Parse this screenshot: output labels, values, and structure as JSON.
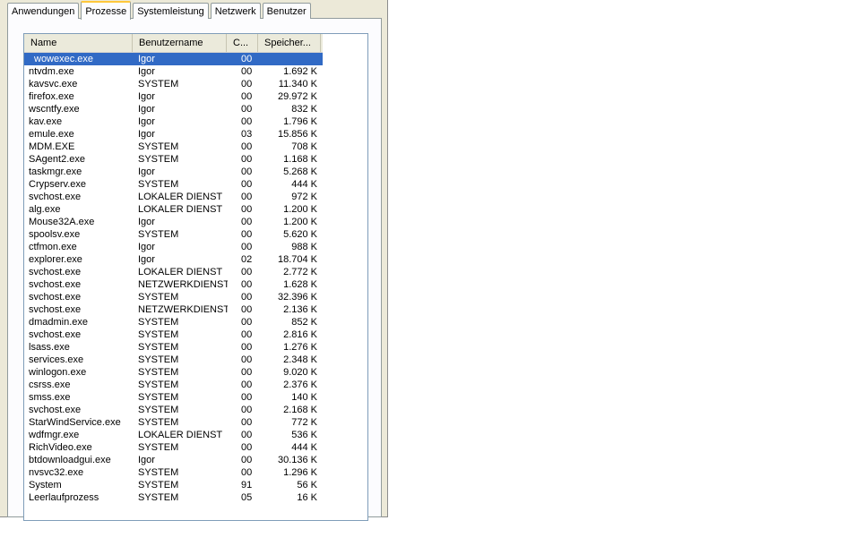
{
  "tabs": [
    {
      "label": "Anwendungen",
      "active": false
    },
    {
      "label": "Prozesse",
      "active": true
    },
    {
      "label": "Systemleistung",
      "active": false
    },
    {
      "label": "Netzwerk",
      "active": false
    },
    {
      "label": "Benutzer",
      "active": false
    }
  ],
  "columns": {
    "name": "Name",
    "user": "Benutzername",
    "cpu": "C...",
    "mem": "Speicher..."
  },
  "selected_index": 0,
  "colors": {
    "selection": "#316ac5",
    "window_bg": "#ece9d8"
  },
  "rows": [
    {
      "name": "wowexec.exe",
      "user": "Igor",
      "cpu": "00",
      "mem": ""
    },
    {
      "name": "ntvdm.exe",
      "user": "Igor",
      "cpu": "00",
      "mem": "1.692 K"
    },
    {
      "name": "kavsvc.exe",
      "user": "SYSTEM",
      "cpu": "00",
      "mem": "11.340 K"
    },
    {
      "name": "firefox.exe",
      "user": "Igor",
      "cpu": "00",
      "mem": "29.972 K"
    },
    {
      "name": "wscntfy.exe",
      "user": "Igor",
      "cpu": "00",
      "mem": "832 K"
    },
    {
      "name": "kav.exe",
      "user": "Igor",
      "cpu": "00",
      "mem": "1.796 K"
    },
    {
      "name": "emule.exe",
      "user": "Igor",
      "cpu": "03",
      "mem": "15.856 K"
    },
    {
      "name": "MDM.EXE",
      "user": "SYSTEM",
      "cpu": "00",
      "mem": "708 K"
    },
    {
      "name": "SAgent2.exe",
      "user": "SYSTEM",
      "cpu": "00",
      "mem": "1.168 K"
    },
    {
      "name": "taskmgr.exe",
      "user": "Igor",
      "cpu": "00",
      "mem": "5.268 K"
    },
    {
      "name": "Crypserv.exe",
      "user": "SYSTEM",
      "cpu": "00",
      "mem": "444 K"
    },
    {
      "name": "svchost.exe",
      "user": "LOKALER DIENST",
      "cpu": "00",
      "mem": "972 K"
    },
    {
      "name": "alg.exe",
      "user": "LOKALER DIENST",
      "cpu": "00",
      "mem": "1.200 K"
    },
    {
      "name": "Mouse32A.exe",
      "user": "Igor",
      "cpu": "00",
      "mem": "1.200 K"
    },
    {
      "name": "spoolsv.exe",
      "user": "SYSTEM",
      "cpu": "00",
      "mem": "5.620 K"
    },
    {
      "name": "ctfmon.exe",
      "user": "Igor",
      "cpu": "00",
      "mem": "988 K"
    },
    {
      "name": "explorer.exe",
      "user": "Igor",
      "cpu": "02",
      "mem": "18.704 K"
    },
    {
      "name": "svchost.exe",
      "user": "LOKALER DIENST",
      "cpu": "00",
      "mem": "2.772 K"
    },
    {
      "name": "svchost.exe",
      "user": "NETZWERKDIENST",
      "cpu": "00",
      "mem": "1.628 K"
    },
    {
      "name": "svchost.exe",
      "user": "SYSTEM",
      "cpu": "00",
      "mem": "32.396 K"
    },
    {
      "name": "svchost.exe",
      "user": "NETZWERKDIENST",
      "cpu": "00",
      "mem": "2.136 K"
    },
    {
      "name": "dmadmin.exe",
      "user": "SYSTEM",
      "cpu": "00",
      "mem": "852 K"
    },
    {
      "name": "svchost.exe",
      "user": "SYSTEM",
      "cpu": "00",
      "mem": "2.816 K"
    },
    {
      "name": "lsass.exe",
      "user": "SYSTEM",
      "cpu": "00",
      "mem": "1.276 K"
    },
    {
      "name": "services.exe",
      "user": "SYSTEM",
      "cpu": "00",
      "mem": "2.348 K"
    },
    {
      "name": "winlogon.exe",
      "user": "SYSTEM",
      "cpu": "00",
      "mem": "9.020 K"
    },
    {
      "name": "csrss.exe",
      "user": "SYSTEM",
      "cpu": "00",
      "mem": "2.376 K"
    },
    {
      "name": "smss.exe",
      "user": "SYSTEM",
      "cpu": "00",
      "mem": "140 K"
    },
    {
      "name": "svchost.exe",
      "user": "SYSTEM",
      "cpu": "00",
      "mem": "2.168 K"
    },
    {
      "name": "StarWindService.exe",
      "user": "SYSTEM",
      "cpu": "00",
      "mem": "772 K"
    },
    {
      "name": "wdfmgr.exe",
      "user": "LOKALER DIENST",
      "cpu": "00",
      "mem": "536 K"
    },
    {
      "name": "RichVideo.exe",
      "user": "SYSTEM",
      "cpu": "00",
      "mem": "444 K"
    },
    {
      "name": "btdownloadgui.exe",
      "user": "Igor",
      "cpu": "00",
      "mem": "30.136 K"
    },
    {
      "name": "nvsvc32.exe",
      "user": "SYSTEM",
      "cpu": "00",
      "mem": "1.296 K"
    },
    {
      "name": "System",
      "user": "SYSTEM",
      "cpu": "91",
      "mem": "56 K"
    },
    {
      "name": "Leerlaufprozess",
      "user": "SYSTEM",
      "cpu": "05",
      "mem": "16 K"
    }
  ]
}
